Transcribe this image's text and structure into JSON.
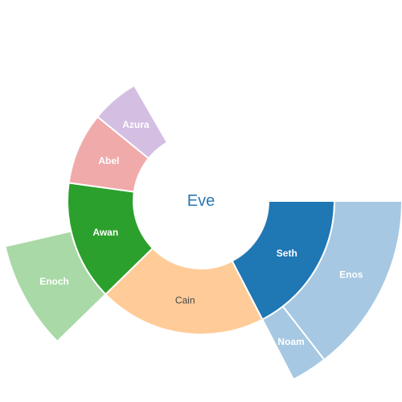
{
  "chart_data": {
    "type": "sunburst",
    "root": {
      "label": "Eve",
      "color": "#2a78b4"
    },
    "segments": [
      {
        "label": "Seth",
        "parent": "Eve",
        "value": 12,
        "color": "#1f77b4",
        "label_color": "#ffffff"
      },
      {
        "label": "Enos",
        "parent": "Seth",
        "value": 10,
        "color": "#a6c8e2",
        "label_color": "#ffffff"
      },
      {
        "label": "Noam",
        "parent": "Seth",
        "value": 2,
        "color": "#a6c8e2",
        "label_color": "#ffffff"
      },
      {
        "label": "Cain",
        "parent": "Eve",
        "value": 14,
        "color": "#ffcc99",
        "label_color": "#444444"
      },
      {
        "label": "Awan",
        "parent": "Eve",
        "value": 10,
        "color": "#2ca02c",
        "label_color": "#ffffff"
      },
      {
        "label": "Enoch",
        "parent": "Awan",
        "value": 6,
        "color": "#a9d9a6",
        "label_color": "#ffffff"
      },
      {
        "label": "Abel",
        "parent": "Eve",
        "value": 6,
        "color": "#f0aaaa",
        "label_color": "#ffffff"
      },
      {
        "label": "Azura",
        "parent": "Eve",
        "value": 4,
        "color": "#d4bfe3",
        "label_color": "#ffffff"
      }
    ]
  }
}
